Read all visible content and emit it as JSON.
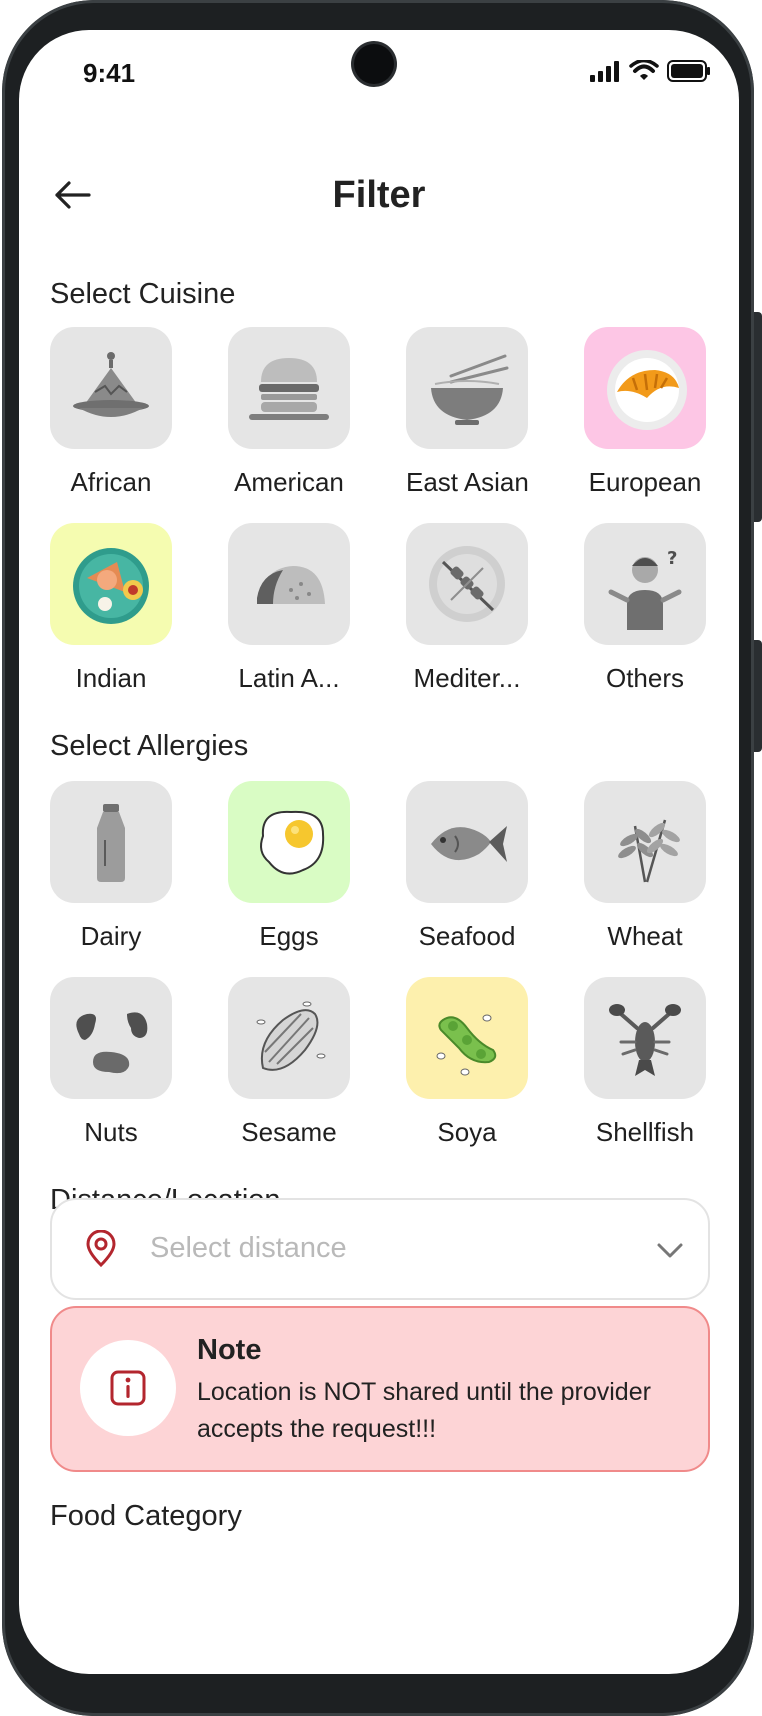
{
  "status": {
    "time": "9:41"
  },
  "header": {
    "title": "Filter"
  },
  "cuisine": {
    "title": "Select Cuisine",
    "items": [
      {
        "label": "African",
        "bg": "#e5e5e5"
      },
      {
        "label": "American",
        "bg": "#e5e5e5"
      },
      {
        "label": "East Asian",
        "bg": "#e5e5e5"
      },
      {
        "label": "European",
        "bg": "#fdc6e5"
      },
      {
        "label": "Indian",
        "bg": "#f5fcb0"
      },
      {
        "label": "Latin A...",
        "bg": "#e5e5e5"
      },
      {
        "label": "Mediter...",
        "bg": "#e5e5e5"
      },
      {
        "label": "Others",
        "bg": "#e5e5e5"
      }
    ]
  },
  "allergies": {
    "title": "Select Allergies",
    "items": [
      {
        "label": "Dairy",
        "bg": "#e5e5e5"
      },
      {
        "label": "Eggs",
        "bg": "#d9fcc4"
      },
      {
        "label": "Seafood",
        "bg": "#e5e5e5"
      },
      {
        "label": "Wheat",
        "bg": "#e5e5e5"
      },
      {
        "label": "Nuts",
        "bg": "#e5e5e5"
      },
      {
        "label": "Sesame",
        "bg": "#e5e5e5"
      },
      {
        "label": "Soya",
        "bg": "#fdf0ad"
      },
      {
        "label": "Shellfish",
        "bg": "#e5e5e5"
      }
    ]
  },
  "distance": {
    "title": "Distance/Location",
    "placeholder": "Select distance"
  },
  "note": {
    "title": "Note",
    "body": "Location is NOT shared until the provider accepts the request!!!"
  },
  "food_category": {
    "title": "Food Category"
  },
  "colors": {
    "accent": "#b3262e",
    "note_bg": "#fdd4d6",
    "note_border": "#f08a8a",
    "tile_default": "#e5e5e5"
  }
}
